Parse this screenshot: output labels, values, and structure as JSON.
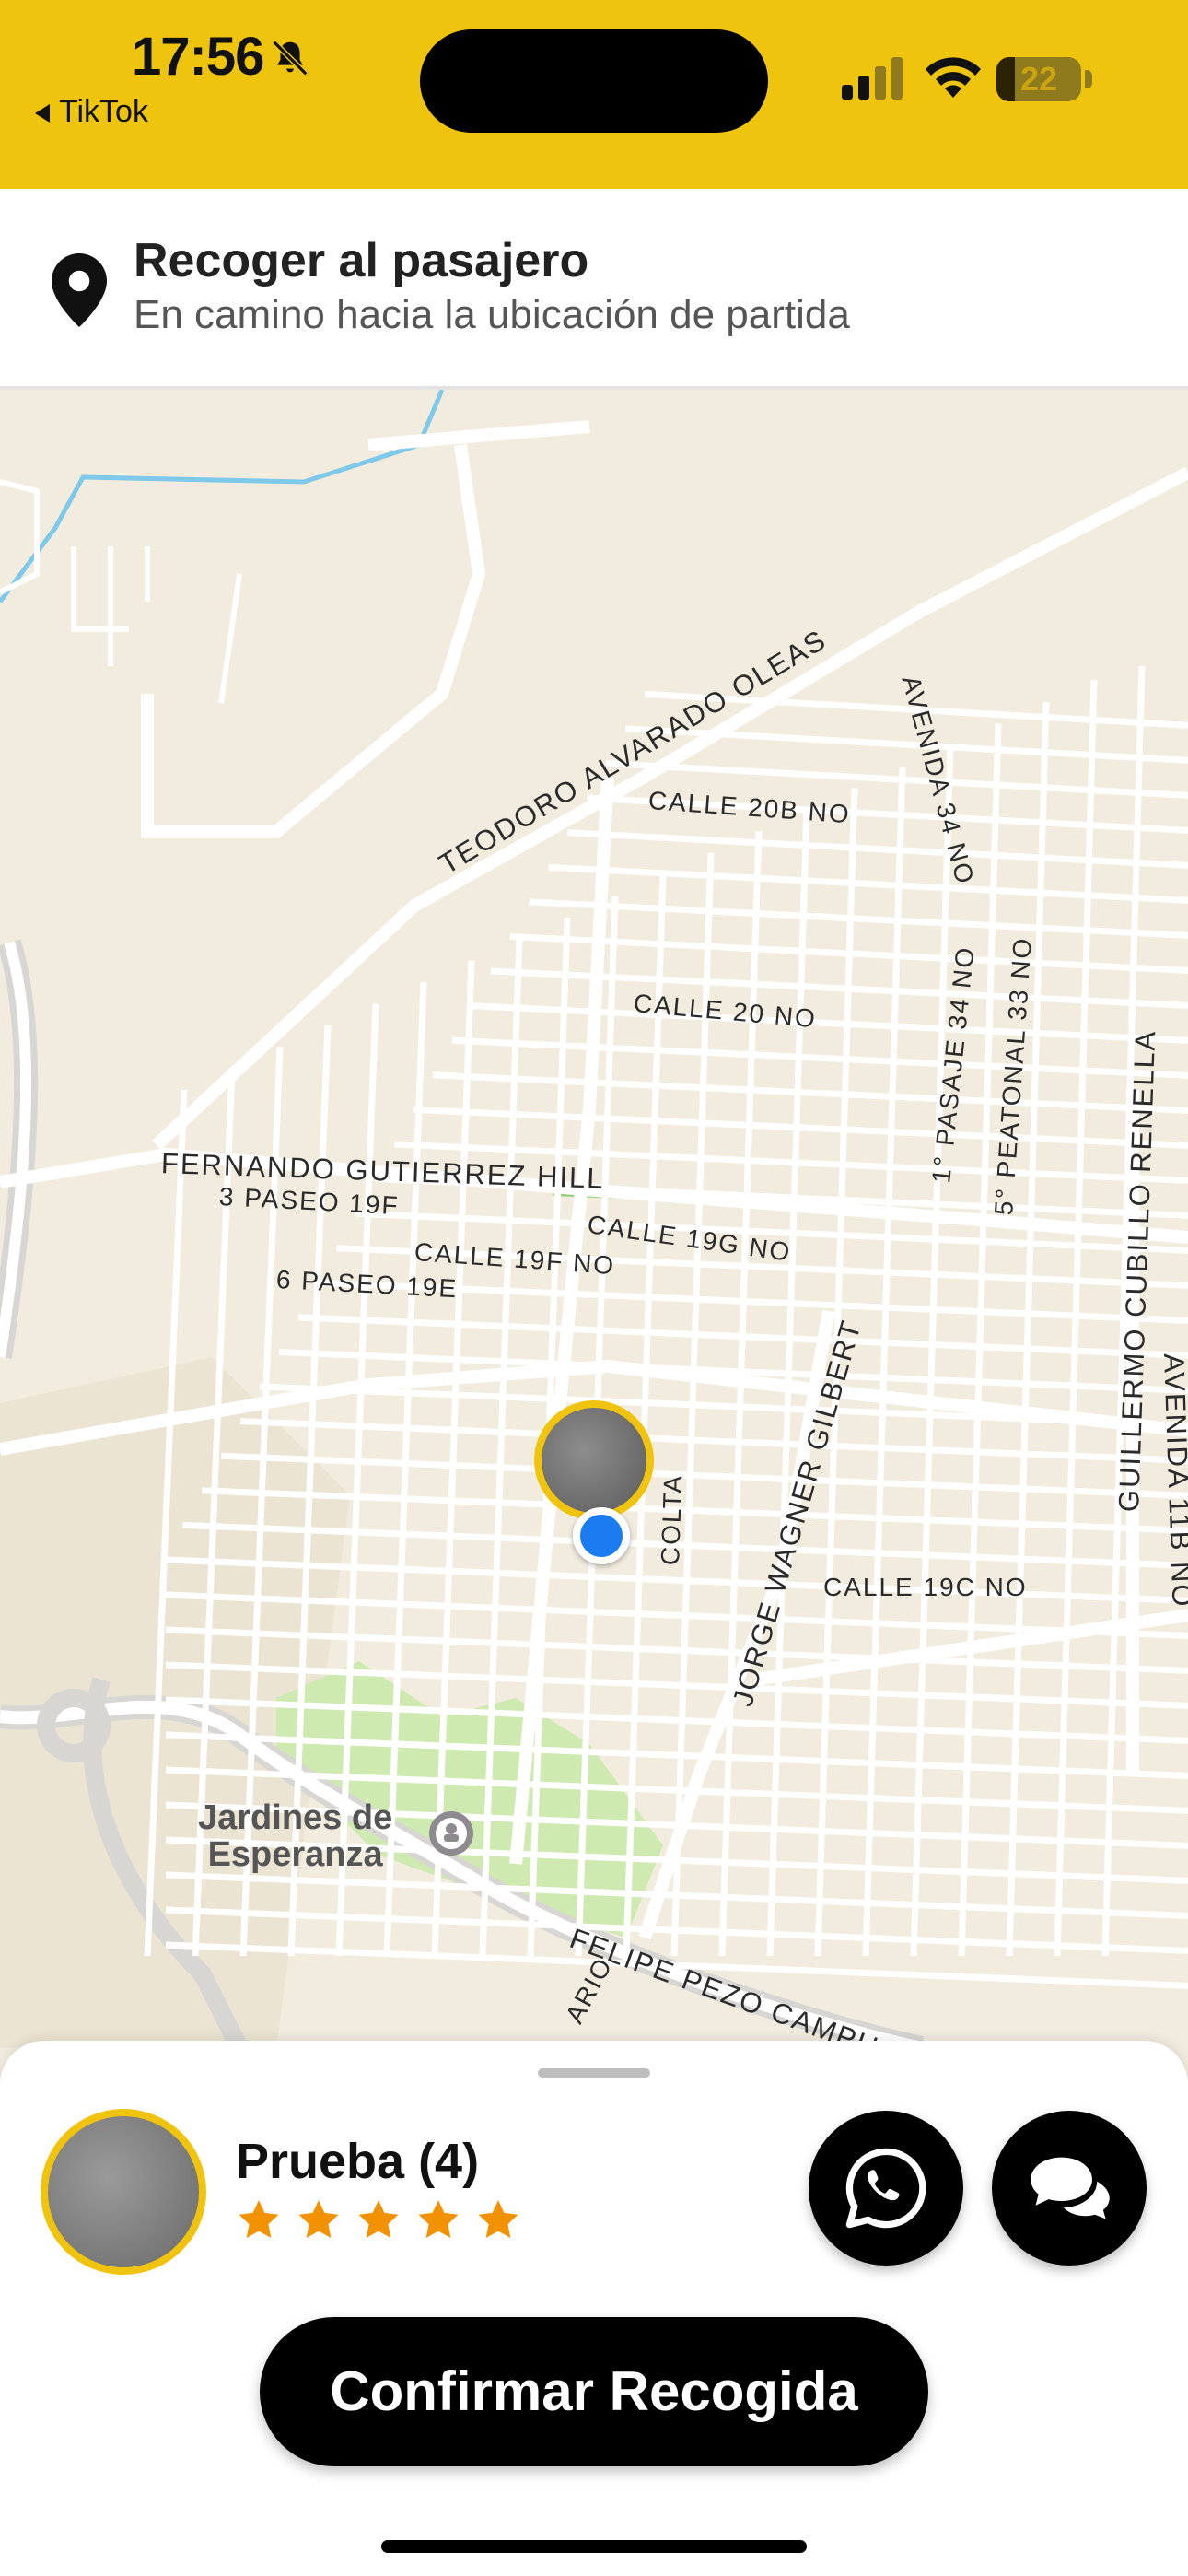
{
  "status_bar": {
    "time": "17:56",
    "back_app": "TikTok",
    "battery": 22,
    "bg_color": "#efc40e",
    "icons": [
      "bell-slash-icon",
      "signal-icon",
      "wifi-icon",
      "battery-icon"
    ]
  },
  "trip_header": {
    "icon": "location-pin-icon",
    "title": "Recoger al pasajero",
    "subtitle": "En camino hacia la ubicación de partida"
  },
  "map": {
    "roads": {
      "teodoro": "TEODORO ALVARADO OLEAS",
      "calle20b": "CALLE 20B NO",
      "avenida34": "AVENIDA 34 NO",
      "calle20": "CALLE 20 NO",
      "pasaje34": "1° PASAJE 34 NO",
      "peatonal33": "5° PEATONAL 33 NO",
      "cubillo": "GUILLERMO CUBILLO RENELLA",
      "fernando": "FERNANDO GUTIERREZ HILL",
      "paseo19f": "3 PASEO 19F",
      "calle19g": "CALLE 19G NO",
      "calle19f": "CALLE 19F NO",
      "paseo19e": "6 PASEO 19E",
      "jorge": "JORGE WAGNER GILBERT",
      "colta": "COLTA",
      "avenida11b": "AVENIDA 11B NO",
      "calle19c": "CALLE 19C NO",
      "felipe": "FELIPE PEZO CAMPU",
      "rosario": "ARIO"
    },
    "poi": {
      "name": "Jardines de\nEsperanza",
      "icon": "cemetery-icon"
    }
  },
  "bottom_sheet": {
    "passenger_name": "Prueba (4)",
    "rating": 5,
    "rating_max": 5,
    "whatsapp_icon": "whatsapp-icon",
    "chat_icon": "chat-bubbles-icon",
    "confirm_label": "Confirmar Recogida",
    "accent_color": "#f0c40e",
    "star_color": "#f39200"
  }
}
